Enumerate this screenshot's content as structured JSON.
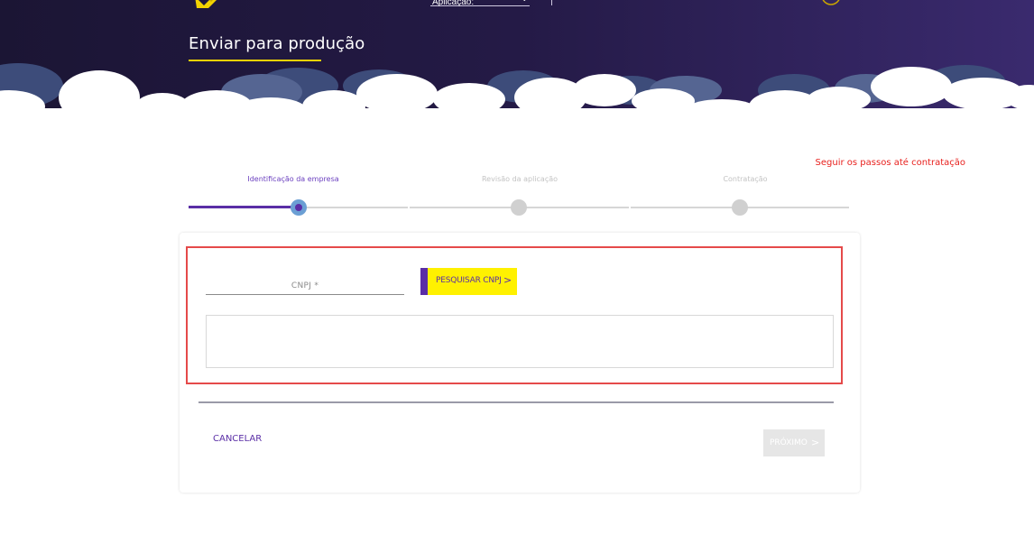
{
  "header": {
    "app_select_label": "Aplicação:",
    "page_title": "Enviar para produção"
  },
  "stepper": {
    "hint": "Seguir os passos até contratação",
    "steps": [
      {
        "label": "Identificação da empresa",
        "state": "active"
      },
      {
        "label": "Revisão da aplicação",
        "state": "pending"
      },
      {
        "label": "Contratação",
        "state": "pending"
      }
    ]
  },
  "form": {
    "cnpj_placeholder": "CNPJ *",
    "cnpj_value": "",
    "search_button": "PESQUISAR CNPJ",
    "search_chevron": ">",
    "cancel_label": "CANCELAR",
    "next_button": "PRÓXIMO",
    "next_chevron": ">"
  },
  "colors": {
    "brand_purple": "#5a2ea6",
    "brand_yellow": "#fff100",
    "header_bg": "#1f1739",
    "alert_red": "#e8211e"
  },
  "icons": [
    "logo-icon",
    "chevron-down-icon",
    "user-icon",
    "chevron-right-icon"
  ]
}
